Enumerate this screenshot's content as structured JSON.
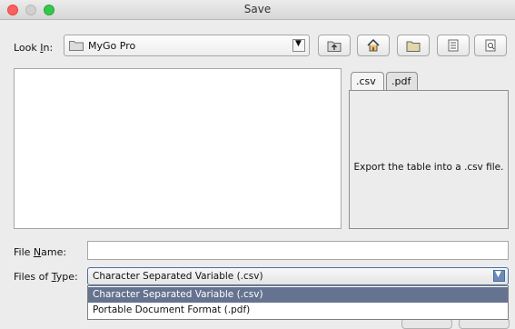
{
  "window": {
    "title": "Save"
  },
  "look_in": {
    "label_pre": "Look ",
    "label_mnemonic": "I",
    "label_post": "n:",
    "selected": "MyGo Pro",
    "icon": "folder-icon"
  },
  "toolbar": {
    "buttons": [
      {
        "name": "up-one-level",
        "icon": "folder-up-icon"
      },
      {
        "name": "home",
        "icon": "home-icon"
      },
      {
        "name": "new-folder",
        "icon": "new-folder-icon"
      },
      {
        "name": "list-view",
        "icon": "list-view-icon"
      },
      {
        "name": "details-view",
        "icon": "details-view-icon"
      }
    ]
  },
  "accessory": {
    "tabs": [
      ".csv",
      ".pdf"
    ],
    "active_tab": ".csv",
    "description": "Export the table into a .csv file."
  },
  "file_name": {
    "label_pre": "File ",
    "label_mnemonic": "N",
    "label_post": "ame:",
    "value": ""
  },
  "file_type": {
    "label_pre": "Files of ",
    "label_mnemonic": "T",
    "label_post": "ype:",
    "selected": "Character Separated Variable (.csv)",
    "options": [
      "Character Separated Variable (.csv)",
      "Portable Document Format (.pdf)"
    ]
  },
  "colors": {
    "selection": "#657390",
    "close": "#fc605c",
    "zoom": "#34c84a"
  }
}
